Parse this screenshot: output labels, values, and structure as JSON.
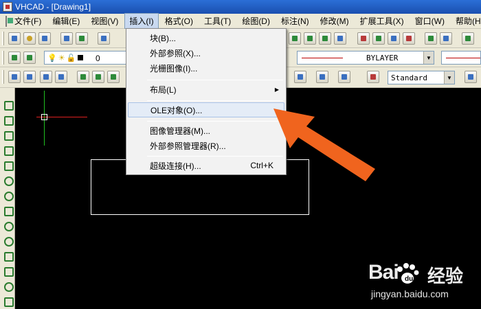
{
  "window": {
    "title": "VHCAD - [Drawing1]"
  },
  "menubar": {
    "items": [
      "文件(F)",
      "编辑(E)",
      "视图(V)",
      "插入(I)",
      "格式(O)",
      "工具(T)",
      "绘图(D)",
      "标注(N)",
      "修改(M)",
      "扩展工具(X)",
      "窗口(W)",
      "帮助(H)"
    ],
    "active_index": 3
  },
  "toolbar": {
    "layer_name": "0",
    "linetype": "BYLAYER",
    "text_style": "Standard"
  },
  "insert_menu": {
    "items": [
      {
        "label": "块(B)...",
        "shortcut": ""
      },
      {
        "label": "外部参照(X)...",
        "shortcut": ""
      },
      {
        "label": "光栅图像(I)...",
        "shortcut": ""
      },
      {
        "label": "布局(L)",
        "shortcut": "",
        "submenu": true
      },
      {
        "label": "OLE对象(O)...",
        "shortcut": "",
        "highlighted": true
      },
      {
        "label": "图像管理器(M)...",
        "shortcut": ""
      },
      {
        "label": "外部参照管理器(R)...",
        "shortcut": ""
      },
      {
        "label": "超级连接(H)...",
        "shortcut": "Ctrl+K"
      }
    ]
  },
  "colors": {
    "accent_arrow": "#f0641e",
    "titlebar": "#1a4fb0",
    "menu_bg": "#ece9d8"
  },
  "watermark": {
    "brand": "Bai",
    "brand_suffix": "经验",
    "url": "jingyan.baidu.com"
  }
}
